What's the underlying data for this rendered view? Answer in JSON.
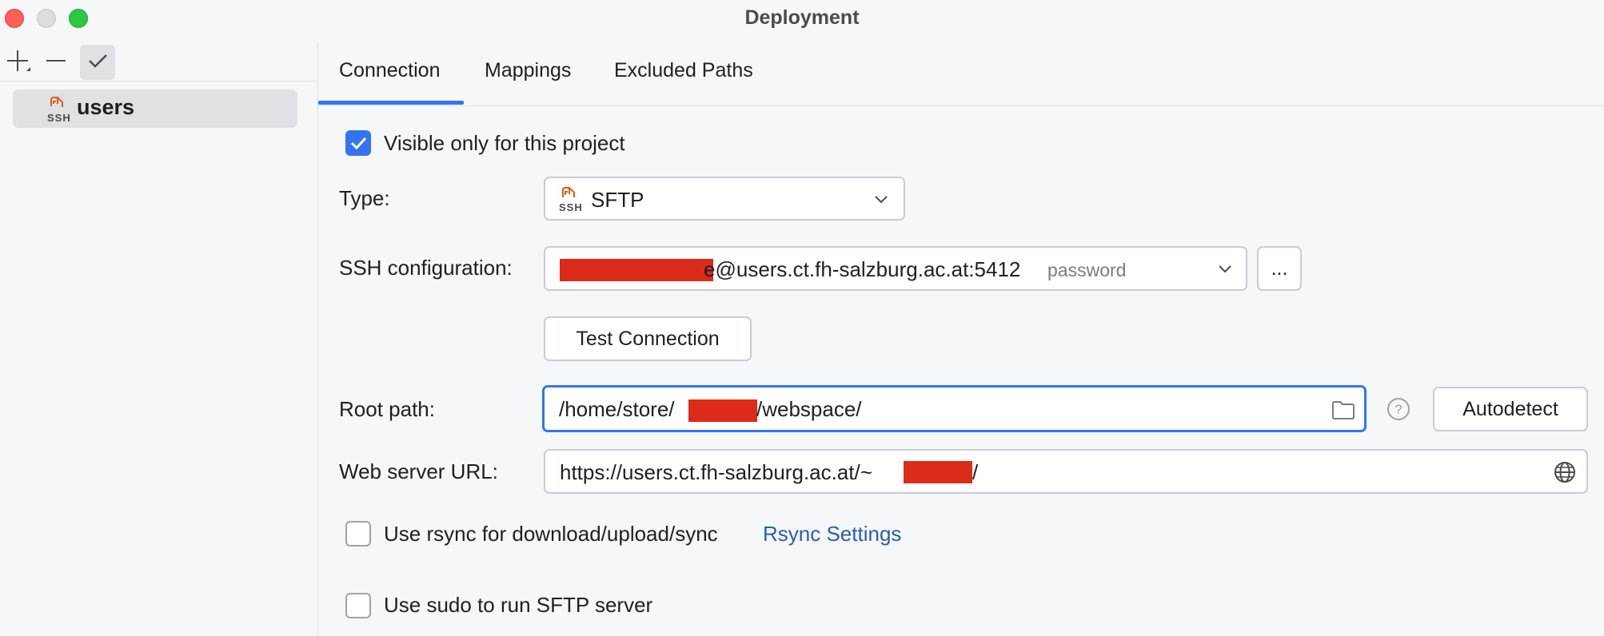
{
  "window": {
    "title": "Deployment"
  },
  "left_pane": {
    "toolbar": {
      "add_icon": "plus-icon",
      "remove_icon": "minus-icon",
      "default_icon": "check-icon"
    },
    "items": [
      {
        "label": "users",
        "icon": "ssh-icon",
        "icon_text": "SSH",
        "selected": true
      }
    ]
  },
  "tabs": [
    {
      "label": "Connection",
      "active": true
    },
    {
      "label": "Mappings",
      "active": false
    },
    {
      "label": "Excluded Paths",
      "active": false
    }
  ],
  "connection": {
    "visible_only_label": "Visible only for this project",
    "visible_only_checked": true,
    "type_label": "Type:",
    "type_value": "SFTP",
    "type_icon_text": "SSH",
    "ssh_config_label": "SSH configuration:",
    "ssh_config_value": "e@users.ct.fh-salzburg.ac.at:5412",
    "ssh_config_auth": "password",
    "browse_label": "...",
    "test_connection_label": "Test Connection",
    "root_path_label": "Root path:",
    "root_path_prefix": "/home/store/",
    "root_path_suffix": "/webspace/",
    "autodetect_label": "Autodetect",
    "web_url_label": "Web server URL:",
    "web_url_prefix": "https://users.ct.fh-salzburg.ac.at/~",
    "web_url_suffix": "/",
    "rsync_label": "Use rsync for download/upload/sync",
    "rsync_checked": false,
    "rsync_settings_link": "Rsync Settings",
    "sudo_label": "Use sudo to run SFTP server",
    "sudo_checked": false
  },
  "colors": {
    "accent": "#3574f0",
    "link": "#2a5db0",
    "redaction": "#dd2b1a",
    "ssh_icon": "#e8590c"
  }
}
